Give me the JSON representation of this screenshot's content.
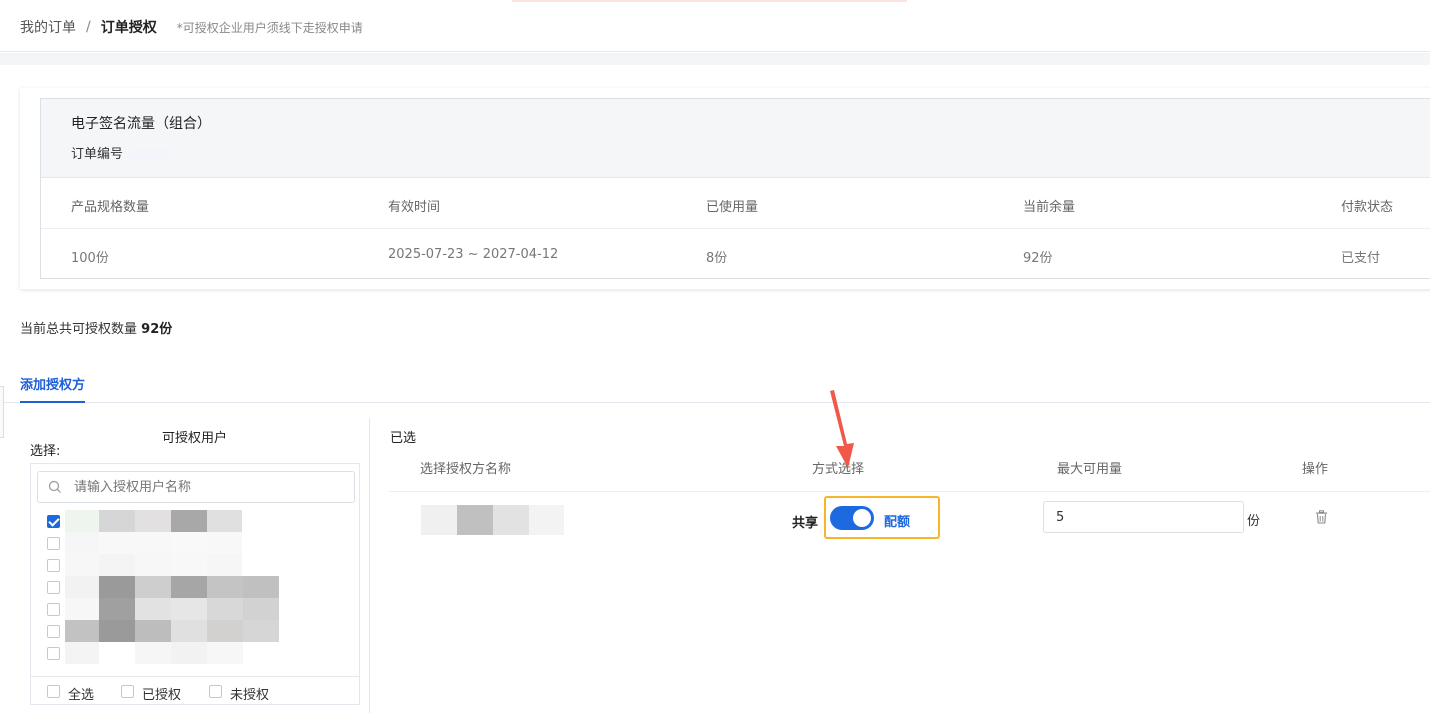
{
  "breadcrumb": {
    "parent": "我的订单",
    "separator": "/",
    "current": "订单授权",
    "note": "*可授权企业用户须线下走授权申请"
  },
  "order": {
    "product_name": "电子签名流量（组合）",
    "order_no_label": "订单编号",
    "columns": [
      "产品规格数量",
      "有效时间",
      "已使用量",
      "当前余量",
      "付款状态"
    ],
    "row": [
      "100份",
      "2025-07-23 ~ 2027-04-12",
      "8份",
      "92份",
      "已支付"
    ]
  },
  "summary": {
    "label": "当前总共可授权数量",
    "value": "92份"
  },
  "tabs": {
    "active": "添加授权方"
  },
  "left_panel": {
    "title": "可授权用户",
    "choose_label": "选择:",
    "search_placeholder": "请输入授权用户名称",
    "search_icon": "search-icon",
    "checked_states": [
      true,
      false,
      false,
      false,
      false,
      false,
      false
    ],
    "footer": {
      "select_all": "全选",
      "authorized": "已授权",
      "unauthorized": "未授权"
    }
  },
  "right_panel": {
    "title": "已选",
    "columns": [
      "选择授权方名称",
      "方式选择",
      "最大可用量",
      "操作"
    ],
    "row": {
      "mode_left": "共享",
      "mode_right": "配额",
      "mode_on": true,
      "max_value": "5",
      "unit": "份",
      "action_icon": "trash-icon"
    }
  },
  "colors": {
    "accent": "#1d6ae0",
    "highlight": "#f7b52c",
    "arrow": "#f0584a"
  }
}
